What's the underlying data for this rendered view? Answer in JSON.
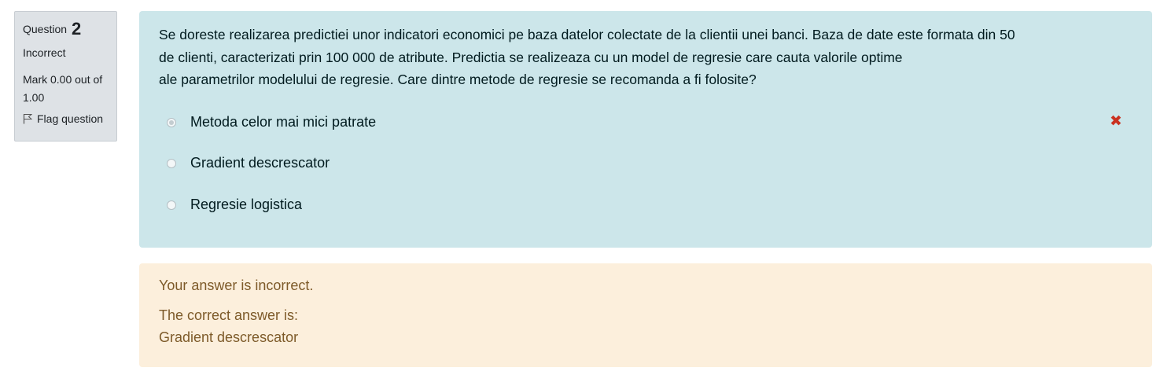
{
  "info": {
    "question_label": "Question",
    "question_number": "2",
    "state": "Incorrect",
    "grade": "Mark 0.00 out of 1.00",
    "flag_label": "Flag question"
  },
  "question": {
    "line1": "Se doreste realizarea predictiei unor indicatori economici pe baza datelor colectate de la clientii unei banci. Baza de date este formata din 50",
    "line2": "de clienti, caracterizati prin 100 000 de atribute. Predictia se realizeaza cu un model de regresie care cauta valorile optime",
    "line3": "ale parametrilor modelului de regresie. Care dintre metode de regresie se recomanda a fi folosite?",
    "answers": [
      {
        "label": "Metoda celor mai mici patrate",
        "selected": true,
        "mark": "incorrect"
      },
      {
        "label": "Gradient descrescator",
        "selected": false
      },
      {
        "label": "Regresie logistica",
        "selected": false
      }
    ],
    "incorrect_icon": "close-icon",
    "incorrect_color": "#ca3120"
  },
  "feedback": {
    "status": "Your answer is incorrect.",
    "correct_label": "The correct answer is:",
    "correct_answer": "Gradient descrescator"
  },
  "colors": {
    "content_bg": "#cce6ea",
    "feedback_bg": "#fcefdc",
    "info_bg": "#dee2e6"
  }
}
